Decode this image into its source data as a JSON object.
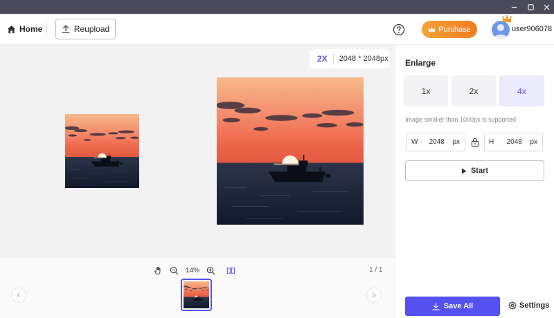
{
  "window": {
    "controls": [
      "minimize-icon",
      "maximize-icon",
      "close-icon"
    ]
  },
  "toolbar": {
    "home_label": "Home",
    "reupload_label": "Reupload",
    "purchase_label": "Purchase",
    "username": "user906078"
  },
  "canvas": {
    "scale_badge": "2X",
    "output_dims": "2048 * 2048px"
  },
  "bottom": {
    "zoom_level": "14%",
    "page_count": "1 / 1"
  },
  "panel": {
    "title": "Enlarge",
    "scale_options": [
      {
        "label": "1x",
        "selected": false
      },
      {
        "label": "2x",
        "selected": false
      },
      {
        "label": "4x",
        "selected": true
      }
    ],
    "hint": "Image smaller than 1000px is supported",
    "width_field": {
      "label": "W",
      "value": "2048",
      "unit": "px"
    },
    "height_field": {
      "label": "H",
      "value": "2048",
      "unit": "px"
    },
    "start_label": "Start",
    "save_all_label": "Save All",
    "settings_label": "Settings"
  },
  "colors": {
    "accent": "#5451f0",
    "purchase_start": "#f7a33b",
    "purchase_end": "#f27c20",
    "titlebar": "#4a4a5a"
  }
}
